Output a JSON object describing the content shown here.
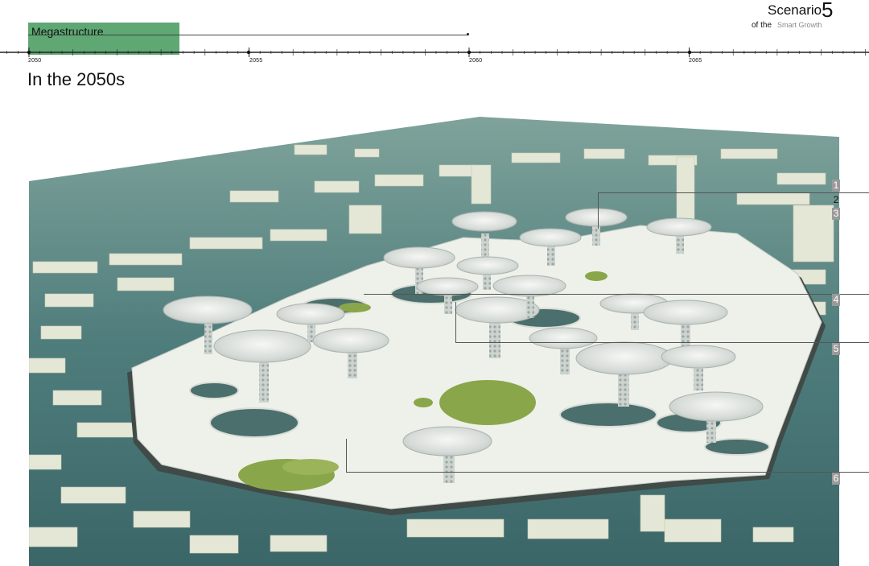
{
  "header": {
    "phase_label": "Megastructure",
    "timeline_years": [
      "2050",
      "2055",
      "2060",
      "2065"
    ],
    "scenario_word": "Scenario",
    "scenario_number": "5",
    "subtitle_prefix": "of the",
    "subtitle_name": "Smart Growth"
  },
  "heading": "In the 2050s",
  "callouts": [
    "1",
    "2",
    "3",
    "4",
    "5",
    "6"
  ],
  "colors": {
    "phase_bar": "#5fa874",
    "water": "#3f6e70",
    "structure": "#eef0ea",
    "greenery": "#8aa64a"
  }
}
